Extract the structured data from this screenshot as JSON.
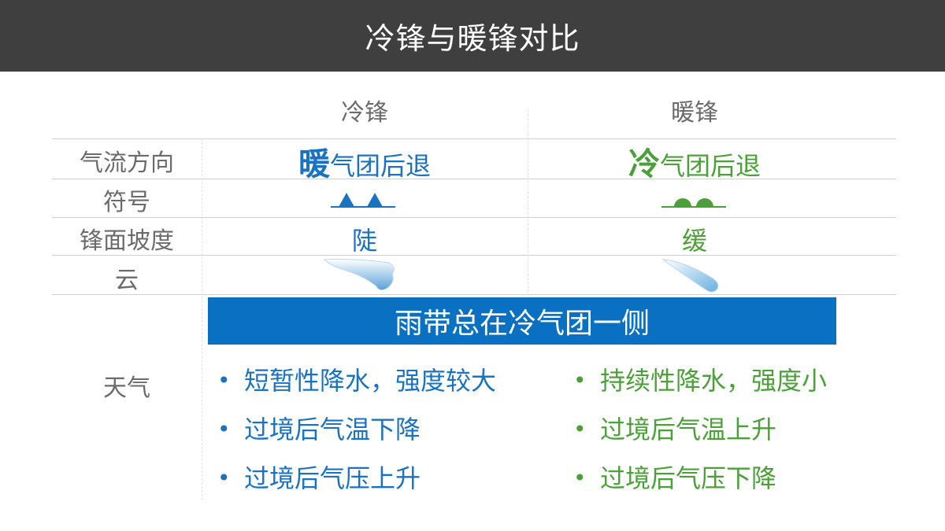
{
  "title": "冷锋与暖锋对比",
  "columns": {
    "cold": "冷锋",
    "warm": "暖锋"
  },
  "rows": {
    "airflow": {
      "label": "气流方向",
      "cold": {
        "lead": "暖",
        "rest": "气团后退"
      },
      "warm": {
        "lead": "冷",
        "rest": "气团后退"
      }
    },
    "symbol": {
      "label": "符号"
    },
    "slope": {
      "label": "锋面坡度",
      "cold": "陡",
      "warm": "缓"
    },
    "cloud": {
      "label": "云"
    },
    "weather": {
      "label": "天气",
      "banner": "雨带总在冷气团一侧",
      "cold": [
        "短暂性降水，强度较大",
        "过境后气温下降",
        "过境后气压上升"
      ],
      "warm": [
        "持续性降水，强度小",
        "过境后气温上升",
        "过境后气压下降"
      ]
    }
  },
  "colors": {
    "cold": "#1b72c0",
    "warm": "#4ca03a",
    "banner": "#0a70c2",
    "title_bar": "#3f3f3f"
  },
  "icons": [
    "cold-front-symbol-icon",
    "warm-front-symbol-icon",
    "cloud-icon"
  ]
}
